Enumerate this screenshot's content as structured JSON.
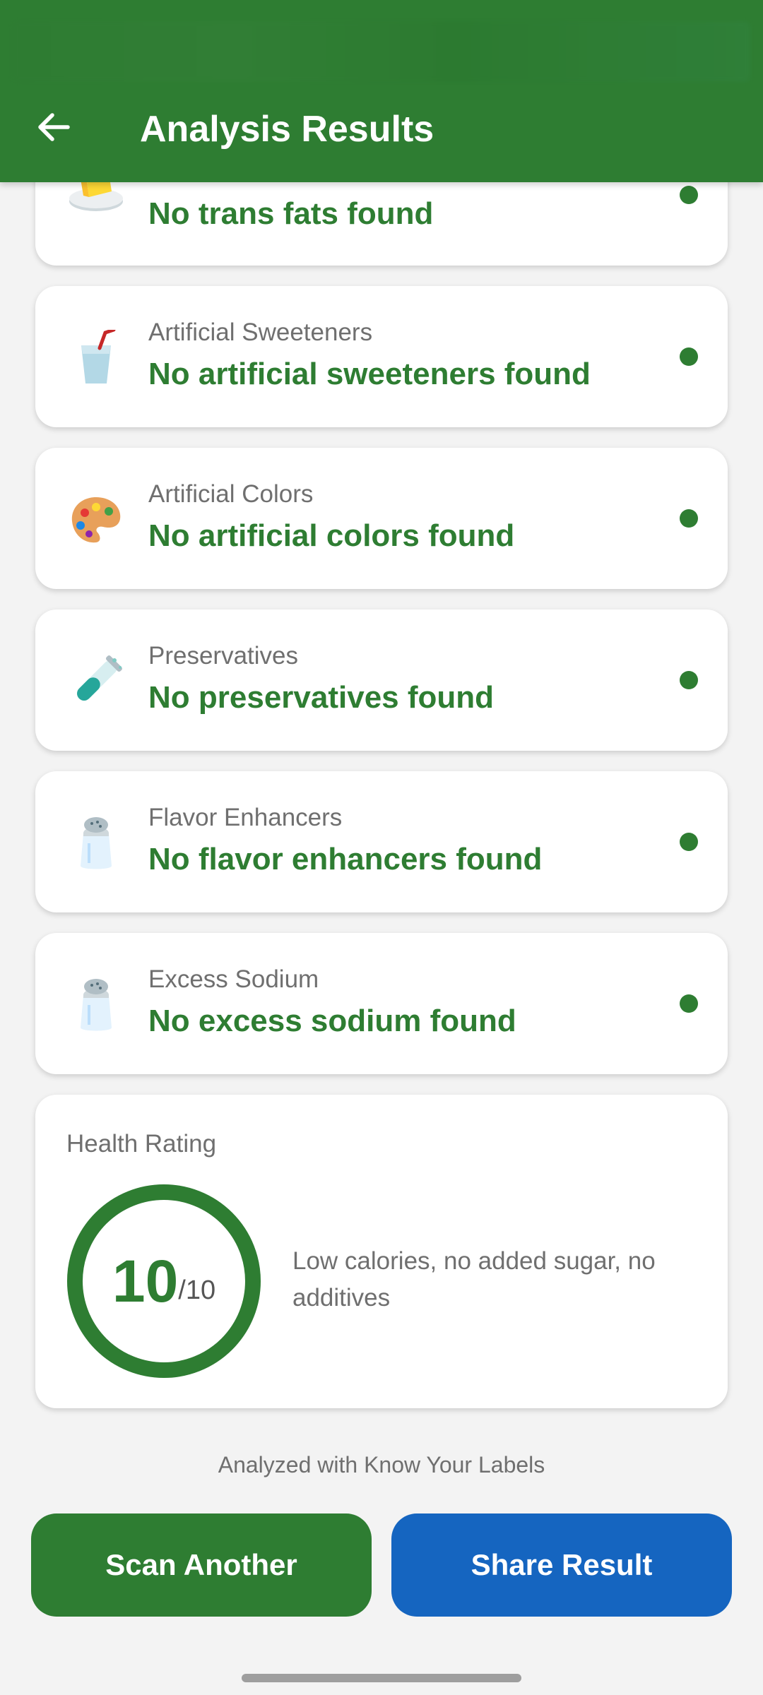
{
  "app_bar": {
    "title": "Analysis Results",
    "back_icon": "arrow-left-icon",
    "color": "#2e7d32"
  },
  "items": [
    {
      "category": "",
      "status": "No trans fats found",
      "icon": "butter-icon"
    },
    {
      "category": "Artificial Sweeteners",
      "status": "No artificial sweeteners found",
      "icon": "cup-with-straw-icon"
    },
    {
      "category": "Artificial Colors",
      "status": "No artificial colors found",
      "icon": "artist-palette-icon"
    },
    {
      "category": "Preservatives",
      "status": "No preservatives found",
      "icon": "test-tube-icon"
    },
    {
      "category": "Flavor Enhancers",
      "status": "No flavor enhancers found",
      "icon": "salt-shaker-icon"
    },
    {
      "category": "Excess Sodium",
      "status": "No excess sodium found",
      "icon": "salt-shaker-icon"
    }
  ],
  "health_rating": {
    "label": "Health Rating",
    "score": "10",
    "max": "/10",
    "description": "Low calories, no added sugar, no additives",
    "fraction": 1.0
  },
  "footer_note": "Analyzed with Know Your Labels",
  "buttons": {
    "scan_another": "Scan Another",
    "share_result": "Share Result"
  },
  "colors": {
    "primary_green": "#2e7d32",
    "share_blue": "#1565c0",
    "background": "#f3f3f3"
  }
}
